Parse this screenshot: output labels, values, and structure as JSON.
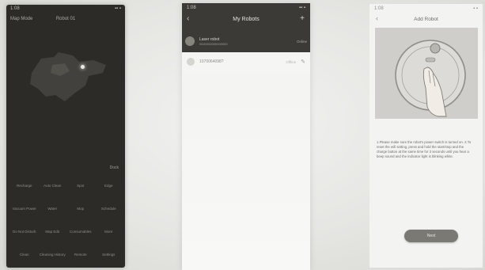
{
  "map_screen": {
    "status_time": "1:08",
    "status_icons": "▪▪ ▪",
    "header_left": "Map Mode",
    "title": "Robot 01",
    "small_label": "Dock",
    "controls": [
      "Recharge",
      "Auto Clean",
      "Spot",
      "Edge",
      "Vacuum Power",
      "Water",
      "Mop",
      "Schedule",
      "Do Not Disturb",
      "Map Edit",
      "Consumables",
      "More",
      "Clean",
      "Cleaning History",
      "Remote",
      "Settings"
    ]
  },
  "robots_screen": {
    "status_time": "1:08",
    "status_icons": "▪▪ ▪",
    "back_icon": "chevron-left-icon",
    "title": "My Robots",
    "add_icon": "plus-icon",
    "robot1": {
      "name": "Laser robot",
      "sub": "0000000000000000",
      "status": "Online"
    },
    "robot2": {
      "id": "1070064098?",
      "status": "Offline",
      "edit_icon": "pencil-icon"
    }
  },
  "add_screen": {
    "status_time": "1:08",
    "status_icons": "▪ ▪",
    "back_icon": "chevron-left-icon",
    "title": "Add Robot",
    "instructions": "1.Please make sure the robot's power switch is turned on. 2.To reset the wifi setting, press and hold the start/stop and the charge button at the same time for 3 seconds until you hear a beep sound and the indicator light is blinking white.",
    "next_button": "Next"
  },
  "background_text": [
    "",
    "",
    "",
    ""
  ]
}
